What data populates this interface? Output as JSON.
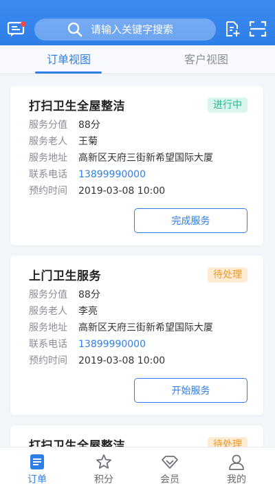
{
  "header": {
    "search_placeholder": "请输入关键字搜索"
  },
  "tabs": [
    {
      "label": "订单视图",
      "active": true
    },
    {
      "label": "客户视图",
      "active": false
    }
  ],
  "labels": {
    "score": "服务分值",
    "elder": "服务老人",
    "address": "服务地址",
    "phone": "联系电话",
    "time": "预约时间"
  },
  "orders": [
    {
      "title": "打扫卫生全屋整洁",
      "status": "进行中",
      "score": "88分",
      "elder": "王菊",
      "address": "高新区天府三街新希望国际大厦",
      "phone": "13899990000",
      "time": "2019-03-08 10:00",
      "action": "完成服务"
    },
    {
      "title": "上门卫生服务",
      "status": "待处理",
      "score": "88分",
      "elder": "李亮",
      "address": "高新区天府三街新希望国际大厦",
      "phone": "13899990000",
      "time": "2019-03-08 10:00",
      "action": "开始服务"
    },
    {
      "title": "打扫卫生全屋整洁",
      "status": "待处理"
    }
  ],
  "nav": [
    {
      "label": "订单",
      "icon": "order-icon",
      "active": true
    },
    {
      "label": "积分",
      "icon": "star-icon",
      "active": false
    },
    {
      "label": "会员",
      "icon": "diamond-icon",
      "active": false
    },
    {
      "label": "我的",
      "icon": "person-icon",
      "active": false
    }
  ],
  "colors": {
    "primary": "#2e7ee8",
    "status_in_progress": "#27b98f",
    "status_pending": "#ef9a2b",
    "notification_dot": "#f04b4b"
  }
}
